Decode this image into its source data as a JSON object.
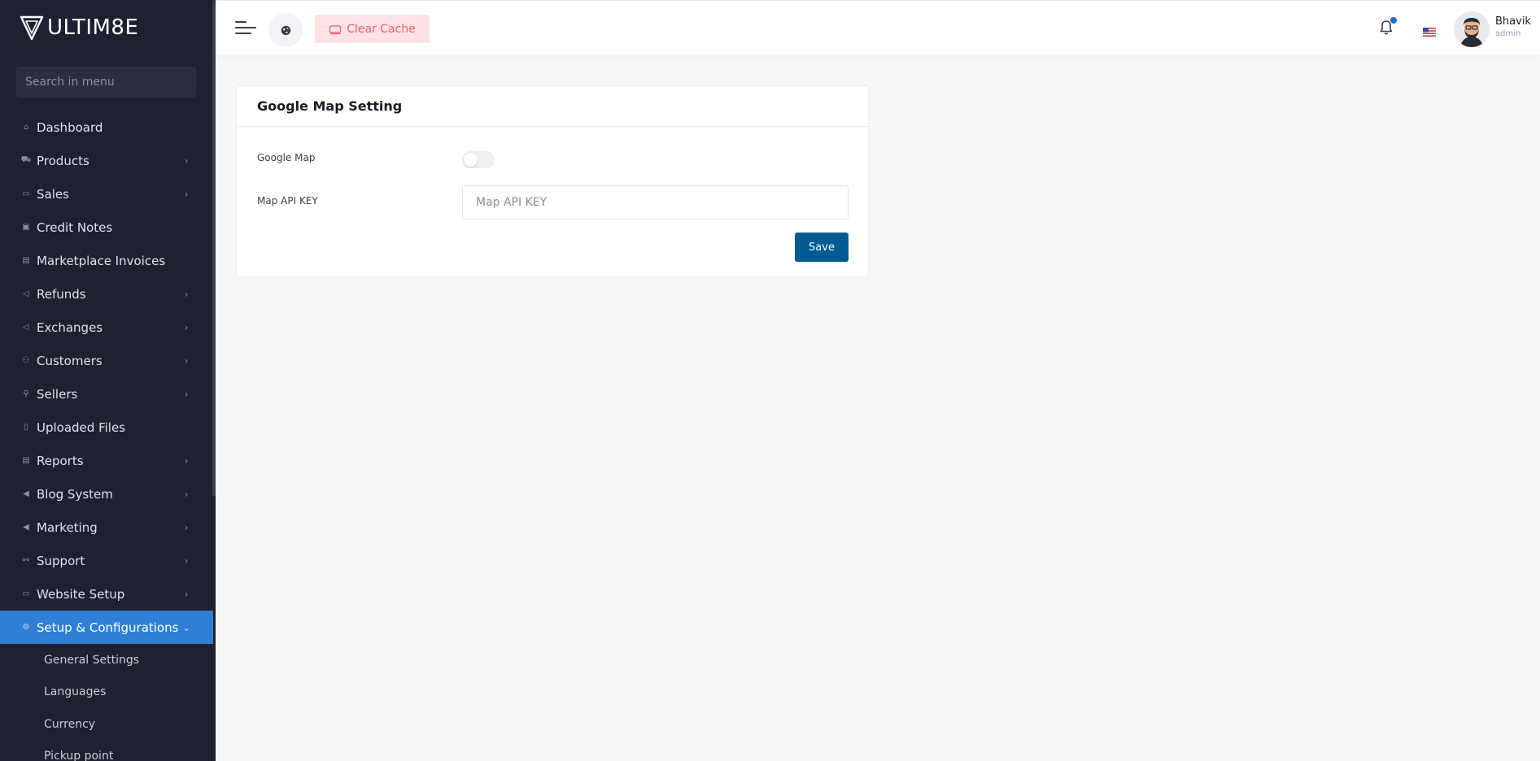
{
  "brand": {
    "logo_text": "ULTIM8E"
  },
  "sidebar": {
    "search_placeholder": "Search in menu",
    "items": [
      {
        "label": "Dashboard",
        "icon": "home-icon",
        "has_children": false
      },
      {
        "label": "Products",
        "icon": "cart-icon",
        "has_children": true
      },
      {
        "label": "Sales",
        "icon": "money-icon",
        "has_children": true
      },
      {
        "label": "Credit Notes",
        "icon": "credit-note-icon",
        "has_children": false
      },
      {
        "label": "Marketplace Invoices",
        "icon": "invoice-icon",
        "has_children": false
      },
      {
        "label": "Refunds",
        "icon": "backward-icon",
        "has_children": true
      },
      {
        "label": "Exchanges",
        "icon": "backward-icon",
        "has_children": true
      },
      {
        "label": "Customers",
        "icon": "users-icon",
        "has_children": true
      },
      {
        "label": "Sellers",
        "icon": "user-icon",
        "has_children": true
      },
      {
        "label": "Uploaded Files",
        "icon": "folder-icon",
        "has_children": false
      },
      {
        "label": "Reports",
        "icon": "report-icon",
        "has_children": true
      },
      {
        "label": "Blog System",
        "icon": "bullhorn-icon",
        "has_children": true
      },
      {
        "label": "Marketing",
        "icon": "bullhorn-icon",
        "has_children": true
      },
      {
        "label": "Support",
        "icon": "link-icon",
        "has_children": true
      },
      {
        "label": "Website Setup",
        "icon": "desktop-icon",
        "has_children": true
      },
      {
        "label": "Setup & Configurations",
        "icon": "gear-icon",
        "has_children": true,
        "active": true
      }
    ],
    "subitems": [
      "General Settings",
      "Languages",
      "Currency",
      "Pickup point"
    ]
  },
  "topbar": {
    "clear_cache_label": "Clear Cache",
    "notification_unread": true,
    "language_flag": "us-flag-icon",
    "user": {
      "name": "Bhavik",
      "role": "admin"
    }
  },
  "card": {
    "title": "Google Map Setting",
    "google_map_label": "Google Map",
    "google_map_enabled": false,
    "api_key_label": "Map API KEY",
    "api_key_value": "",
    "api_key_placeholder": "Map API KEY",
    "save_label": "Save"
  },
  "colors": {
    "sidebar_bg": "#1f2130",
    "active_item_bg": "#2f7fd6",
    "save_button_bg": "#005a94",
    "clear_cache_bg": "#fde1e4",
    "clear_cache_text": "#ef5f72",
    "notification_dot": "#2172c4"
  }
}
